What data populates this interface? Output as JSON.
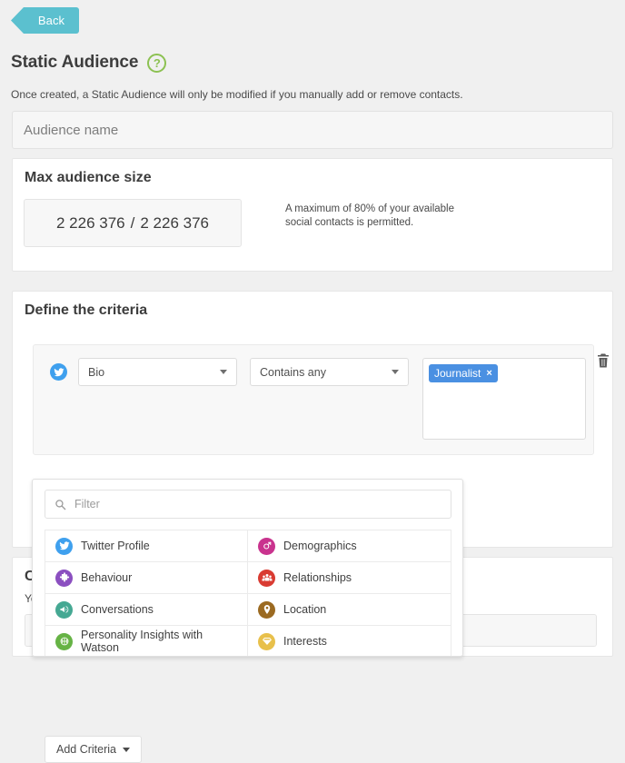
{
  "nav": {
    "back_label": "Back"
  },
  "header": {
    "title": "Static Audience",
    "help_icon": "question-mark-icon",
    "help_label": "?",
    "subtitle": "Once created, a Static Audience will only be modified if you manually add or remove contacts."
  },
  "audience_name": {
    "value": "",
    "placeholder": "Audience name"
  },
  "max_audience": {
    "title": "Max audience size",
    "current": "2 226 376",
    "separator": "/",
    "total": "2 226 376",
    "note": "A maximum of 80% of your available social contacts is permitted."
  },
  "criteria": {
    "title": "Define the criteria",
    "row": {
      "source_icon": "twitter-icon",
      "field": "Bio",
      "operator": "Contains any",
      "tokens": [
        {
          "label": "Journalist",
          "remove": "×"
        }
      ],
      "delete_icon": "trash-icon"
    },
    "add_button": "Add Criteria"
  },
  "hidden_card": {
    "title": "C",
    "subtitle": "Yo"
  },
  "dropdown": {
    "filter": {
      "value": "",
      "placeholder": "Filter",
      "icon": "search-icon"
    },
    "categories": [
      {
        "label": "Twitter Profile",
        "icon": "twitter-icon",
        "color": "#3fa0ee"
      },
      {
        "label": "Demographics",
        "icon": "gender-icon",
        "color": "#c9338e"
      },
      {
        "label": "Behaviour",
        "icon": "puzzle-icon",
        "color": "#8b4fc0"
      },
      {
        "label": "Relationships",
        "icon": "people-icon",
        "color": "#d93b32"
      },
      {
        "label": "Conversations",
        "icon": "megaphone-icon",
        "color": "#45a893"
      },
      {
        "label": "Location",
        "icon": "map-pin-icon",
        "color": "#9b6a21"
      },
      {
        "label": "Personality Insights with Watson",
        "icon": "brain-icon",
        "color": "#66b345"
      },
      {
        "label": "Interests",
        "icon": "diamond-icon",
        "color": "#e8c04b"
      }
    ]
  },
  "colors": {
    "accent_teal": "#5bc0cf",
    "accent_green": "#8cc152",
    "token_blue": "#4a90e2",
    "page_bg": "#f0f0f0"
  }
}
